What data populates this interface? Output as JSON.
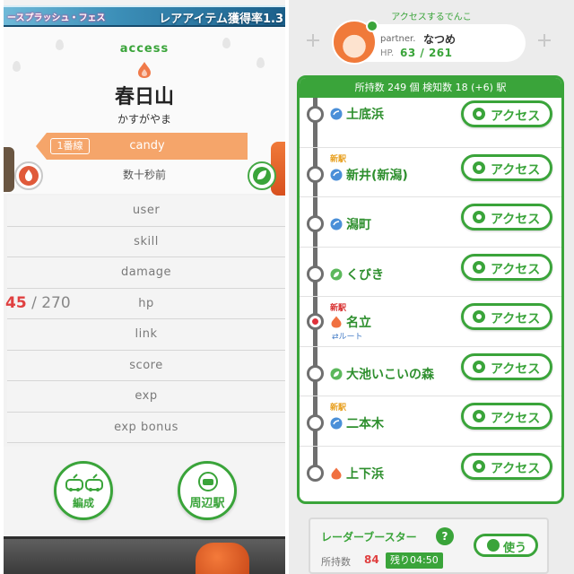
{
  "left": {
    "banner_left": "ースプラッシュ・フェス",
    "banner_right": "レアアイテム獲得率1.3",
    "access_label": "access",
    "station_name": "春日山",
    "station_kana": "かすがやま",
    "line_badge": "1番線",
    "line_denko": "candy",
    "ago": "数十秒前",
    "stats": [
      {
        "label": "user"
      },
      {
        "label": "skill"
      },
      {
        "label": "damage"
      },
      {
        "label": "hp"
      },
      {
        "label": "link"
      },
      {
        "label": "score"
      },
      {
        "label": "exp"
      },
      {
        "label": "exp bonus"
      }
    ],
    "hp_current": "45",
    "hp_rest": " / 270",
    "formation_label": "編成",
    "nearby_label": "周辺駅",
    "colors": {
      "accent": "#3aa43a",
      "line_orange": "#f5a56a",
      "hp_red": "#e04040"
    }
  },
  "right": {
    "partner_title": "アクセスするでんこ",
    "partner_prefix": "partner.",
    "partner_name": "なつめ",
    "hp_label": "HP.",
    "hp_text": "63 / 261",
    "header": "所持数 249 個 検知数 18 (+6) 駅",
    "stations": [
      {
        "name": "土底浜",
        "new": "",
        "icon": "water-drop-icon",
        "route": ""
      },
      {
        "name": "新井(新潟)",
        "new": "新駅",
        "icon": "water-drop-icon",
        "route": ""
      },
      {
        "name": "潟町",
        "new": "",
        "icon": "water-drop-icon",
        "route": ""
      },
      {
        "name": "くびき",
        "new": "",
        "icon": "leaf-icon",
        "route": ""
      },
      {
        "name": "名立",
        "new": "新駅",
        "icon": "fire-icon",
        "route": "ルート"
      },
      {
        "name": "大池いこいの森",
        "new": "",
        "icon": "leaf-icon",
        "route": ""
      },
      {
        "name": "二本木",
        "new": "新駅",
        "icon": "water-drop-icon",
        "route": ""
      },
      {
        "name": "上下浜",
        "new": "",
        "icon": "fire-icon",
        "route": ""
      }
    ],
    "access_button": "アクセス",
    "booster_title": "レーダーブースター",
    "booster_help": "?",
    "booster_use": "使う",
    "owned_label": "所持数",
    "owned_count": "84",
    "remaining": "残り04:50",
    "colors": {
      "accent": "#3aa43a",
      "new_orange": "#e8a020",
      "new_red": "#d83030",
      "water": "#4a8fd8",
      "fire": "#f07040",
      "leaf": "#5cb85c"
    }
  }
}
